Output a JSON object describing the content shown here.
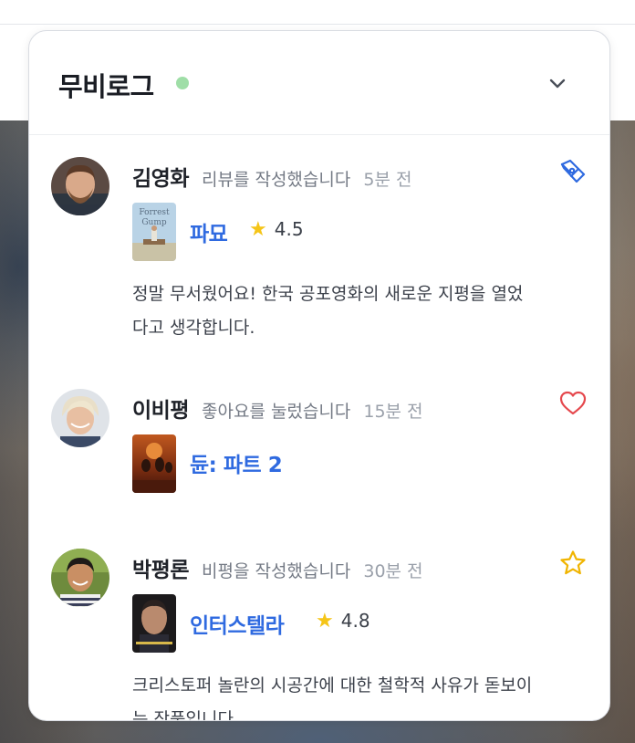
{
  "header": {
    "title": "무비로그",
    "status_color": "#9fdea7"
  },
  "activities": [
    {
      "user": "김영화",
      "action": "리뷰를 작성했습니다",
      "time": "5분 전",
      "icon": "pen-nib-icon",
      "movie": "파묘",
      "rating": "4.5",
      "review": "정말 무서웠어요! 한국 공포영화의 새로운 지평을 열었다고 생각합니다."
    },
    {
      "user": "이비평",
      "action": "좋아요를 눌렀습니다",
      "time": "15분 전",
      "icon": "heart-icon",
      "movie": "듄: 파트 2"
    },
    {
      "user": "박평론",
      "action": "비평을 작성했습니다",
      "time": "30분 전",
      "icon": "star-outline-icon",
      "movie": "인터스텔라",
      "rating": "4.8",
      "review": "크리스토퍼 놀란의 시공간에 대한 철학적 사유가 돋보이는 작품입니다."
    }
  ],
  "colors": {
    "accent_blue": "#2f6ae0",
    "heart_red": "#e5484d",
    "star_yellow": "#f5c518"
  }
}
